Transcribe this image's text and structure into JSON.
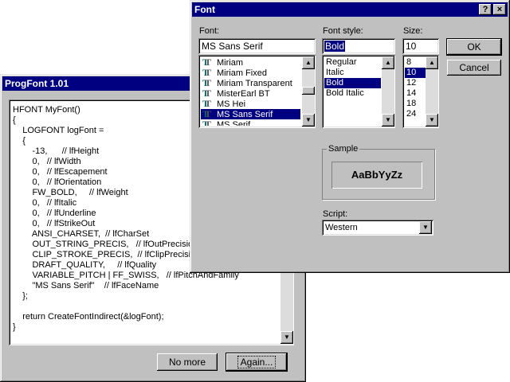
{
  "progfont": {
    "title": "ProgFont 1.01",
    "code_lines": [
      "HFONT MyFont()",
      "{",
      "    LOGFONT logFont =",
      "    {",
      "        -13,      // lfHeight",
      "        0,   // lfWidth",
      "        0,   // lfEscapement",
      "        0,   // lfOrientation",
      "        FW_BOLD,     // lfWeight",
      "        0,   // lfItalic",
      "        0,   // lfUnderline",
      "        0,   // lfStrikeOut",
      "        ANSI_CHARSET,  // lfCharSet",
      "        OUT_STRING_PRECIS,   // lfOutPrecision",
      "        CLIP_STROKE_PRECIS,  // lfClipPrecision",
      "        DRAFT_QUALITY,     // lfQuality",
      "        VARIABLE_PITCH | FF_SWISS,   // lfPitchAndFamily",
      "        \"MS Sans Serif\"    // lfFaceName",
      "    };",
      "",
      "    return CreateFontIndirect(&logFont);",
      "}"
    ],
    "no_more_label": "No more",
    "again_label": "Again..."
  },
  "font_dialog": {
    "title": "Font",
    "help_label": "?",
    "close_label": "×",
    "font_label": "Font:",
    "font_value": "MS Sans Serif",
    "fonts": [
      "Miriam",
      "Miriam Fixed",
      "Miriam Transparent",
      "MisterEarl BT",
      "MS Hei",
      "MS Sans Serif",
      "MS Serif"
    ],
    "selected_font_index": 5,
    "style_label": "Font style:",
    "style_value": "Bold",
    "styles": [
      "Regular",
      "Italic",
      "Bold",
      "Bold Italic"
    ],
    "selected_style_index": 2,
    "size_label": "Size:",
    "size_value": "10",
    "sizes": [
      "8",
      "10",
      "12",
      "14",
      "18",
      "24"
    ],
    "selected_size_index": 1,
    "ok_label": "OK",
    "cancel_label": "Cancel",
    "sample_label": "Sample",
    "sample_text": "AaBbYyZz",
    "script_label": "Script:",
    "script_value": "Western"
  }
}
